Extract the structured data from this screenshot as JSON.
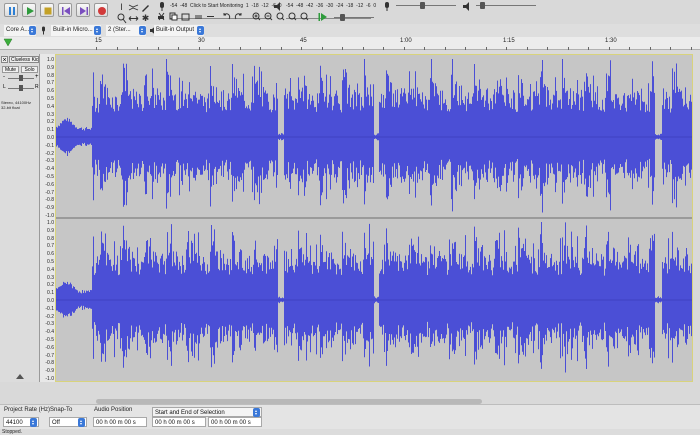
{
  "transport": {
    "buttons": [
      {
        "name": "pause-button",
        "icon": "pause-icon",
        "color": "#2d7fd4"
      },
      {
        "name": "play-button",
        "icon": "play-icon",
        "color": "#2e9b3c"
      },
      {
        "name": "stop-button",
        "icon": "stop-icon",
        "color": "#c4a126"
      },
      {
        "name": "skip-to-start-button",
        "icon": "skip-start-icon",
        "color": "#7a4fbf"
      },
      {
        "name": "skip-to-end-button",
        "icon": "skip-end-icon",
        "color": "#7a4fbf"
      },
      {
        "name": "record-button",
        "icon": "record-icon",
        "color": "#d23a3a"
      }
    ]
  },
  "meters": {
    "record_scale": [
      "-54",
      "-48",
      "Click to Start Monitoring",
      "1",
      "-18",
      "-12",
      "-6",
      "0"
    ],
    "playback_scale": [
      "-54",
      "-48",
      "-42",
      "-36",
      "-30",
      "-24",
      "-18",
      "-12",
      "-6",
      "0"
    ]
  },
  "device_toolbar": {
    "host": "Core A...",
    "recording_device": "Built-in Micro...",
    "channels": "2 (Ster...",
    "playback_device": "Built-in Output"
  },
  "ruler": {
    "labels": [
      "15",
      "30",
      "45",
      "1:00",
      "1:15",
      "1:30"
    ]
  },
  "track": {
    "name": "Clueless Kid",
    "mute_label": "Mute",
    "solo_label": "Solo",
    "gain_minus": "-",
    "gain_plus": "+",
    "pan_left": "L",
    "pan_right": "R",
    "info_line1": "Stereo, 44100Hz",
    "info_line2": "32-bit float",
    "scale_labels": [
      "1.0",
      "0.9",
      "0.8",
      "0.7",
      "0.6",
      "0.5",
      "0.4",
      "0.3",
      "0.2",
      "0.1",
      "0.0",
      "-0.1",
      "-0.2",
      "-0.3",
      "-0.4",
      "-0.5",
      "-0.6",
      "-0.7",
      "-0.8",
      "-0.9",
      "-1.0"
    ],
    "waveform_color": "#4b4fd6"
  },
  "selection_toolbar": {
    "project_rate_label": "Project Rate (Hz)",
    "project_rate_value": "44100",
    "snap_to_label": "Snap-To",
    "snap_to_value": "Off",
    "audio_position_label": "Audio Position",
    "audio_position_value": "00 h 00 m 00 s",
    "selection_mode": "Start and End of Selection",
    "selection_start": "00 h 00 m 00 s",
    "selection_end": "00 h 00 m 00 s"
  },
  "status": "Stopped."
}
